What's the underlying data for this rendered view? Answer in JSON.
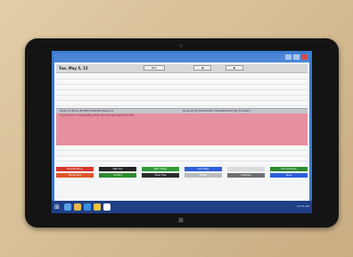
{
  "screen": {
    "header": {
      "date": "Tue, May 5, 15",
      "control_mid": "Bus",
      "control_left": "◀",
      "control_right": "▶"
    },
    "lane_left": "10-Jan-15 Pickup (B) (BLK) Cathedral Square (2)",
    "lane_right": "10-Jan-15 (B) 10:00 Grade 3 Scheduled Field Trip (3) Grade 3",
    "pink_note": "Trip Orchard 3-1 (Grade) Berry Farm (B) 10:00 AM Flight 10:00 AM",
    "row1": [
      {
        "label": "Book Booking",
        "color": "#d6382f"
      },
      {
        "label": "New Trip",
        "color": "#222222"
      },
      {
        "label": "Mark Trippy",
        "color": "#2f9a3a"
      },
      {
        "label": "List Trippy",
        "color": "#2d5ed8"
      },
      {
        "label": "",
        "color": "#d9dadc"
      },
      {
        "label": "Pick Schedule",
        "color": "#2d8a2f"
      }
    ],
    "row2": [
      {
        "label": "Route Trips",
        "color": "#e0572a"
      },
      {
        "label": "Confirm",
        "color": "#2d8a2f"
      },
      {
        "label": "Show Trips",
        "color": "#2b2b2b"
      },
      {
        "label": "Delete",
        "color": "#b9bcc0"
      },
      {
        "label": "Schedule",
        "color": "#6d6f73"
      },
      {
        "label": "Done",
        "color": "#2d5ed8"
      }
    ],
    "tray_text": "10:15 AM"
  }
}
